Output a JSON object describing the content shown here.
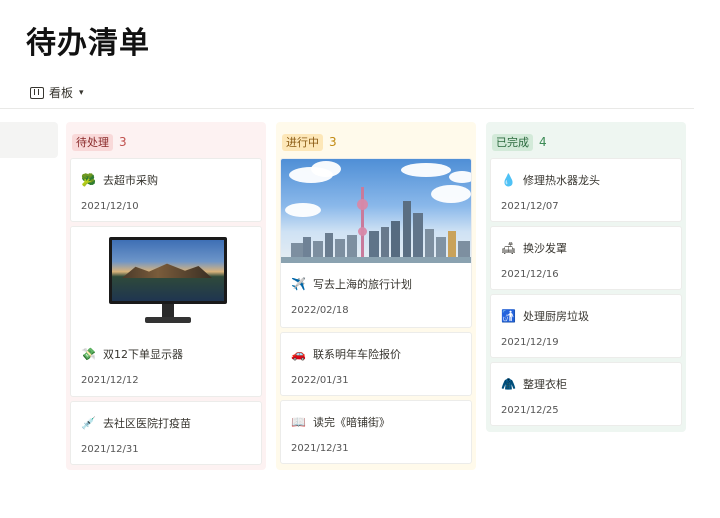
{
  "page": {
    "title": "待办清单"
  },
  "view": {
    "icon": "board-icon",
    "label": "看板",
    "chevron": "▾"
  },
  "columns": [
    {
      "label": "待处理",
      "count": "3",
      "color": "#fdf2f2",
      "cards": [
        {
          "icon": "money-bag-icon",
          "emoji": "🥦",
          "title": "去超市采购",
          "date": "2021/12/10"
        },
        {
          "cover": "monitor-image",
          "icon": "money-icon",
          "emoji": "💸",
          "title": "双12下单显示器",
          "date": "2021/12/12"
        },
        {
          "icon": "syringe-icon",
          "emoji": "💉",
          "title": "去社区医院打疫苗",
          "date": "2021/12/31"
        }
      ]
    },
    {
      "label": "进行中",
      "count": "3",
      "color": "#fffaeb",
      "cards": [
        {
          "cover": "shanghai-skyline-image",
          "icon": "airplane-icon",
          "emoji": "✈️",
          "title": "写去上海的旅行计划",
          "date": "2022/02/18"
        },
        {
          "icon": "car-icon",
          "emoji": "🚗",
          "title": "联系明年车险报价",
          "date": "2022/01/31"
        },
        {
          "icon": "book-icon",
          "emoji": "📖",
          "title": "读完《暗铺街》",
          "date": "2021/12/31"
        }
      ]
    },
    {
      "label": "已完成",
      "count": "4",
      "color": "#eef6f1",
      "cards": [
        {
          "icon": "droplet-icon",
          "emoji": "💧",
          "title": "修理热水器龙头",
          "date": "2021/12/07"
        },
        {
          "icon": "sofa-icon",
          "emoji": "🛋",
          "title": "换沙发罩",
          "date": "2021/12/16"
        },
        {
          "icon": "trash-icon",
          "emoji": "🚮",
          "title": "处理厨房垃圾",
          "date": "2021/12/19"
        },
        {
          "icon": "coat-icon",
          "emoji": "🧥",
          "title": "整理衣柜",
          "date": "2021/12/25"
        }
      ]
    }
  ]
}
